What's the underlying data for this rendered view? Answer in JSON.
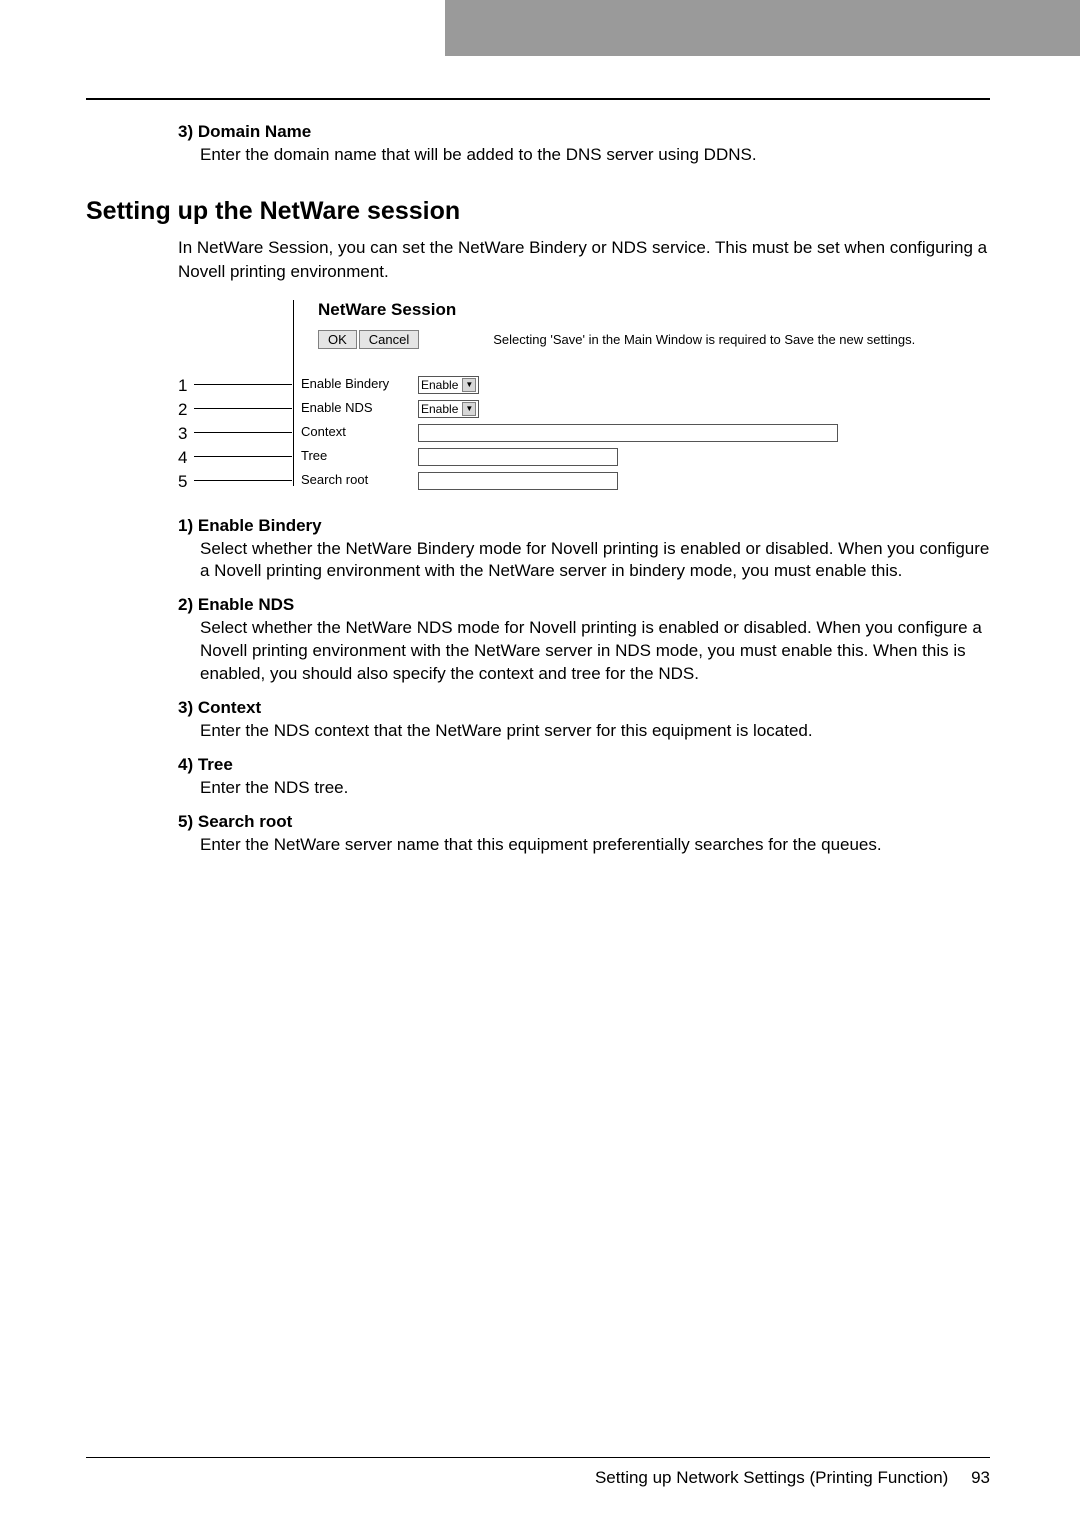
{
  "leadin_item": {
    "num": "3)",
    "title": "Domain Name",
    "body": "Enter the domain name that will be added to the DNS server using DDNS."
  },
  "section_heading": "Setting up the NetWare session",
  "section_intro": "In NetWare Session, you can set the NetWare Bindery or NDS service.  This must be set when configuring a Novell printing environment.",
  "screenshot": {
    "panel_title": "NetWare Session",
    "ok": "OK",
    "cancel": "Cancel",
    "save_note": "Selecting 'Save' in the Main Window is required to Save the new settings.",
    "rows": {
      "enable_bindery_label": "Enable Bindery",
      "enable_nds_label": "Enable NDS",
      "context_label": "Context",
      "tree_label": "Tree",
      "search_root_label": "Search root",
      "enable_option": "Enable"
    }
  },
  "callout_numbers": [
    "1",
    "2",
    "3",
    "4",
    "5"
  ],
  "items": [
    {
      "num": "1)",
      "title": "Enable Bindery",
      "body": "Select whether the NetWare Bindery mode for Novell printing is enabled or disabled.  When you configure a Novell printing environment with the NetWare server in bindery mode, you must enable this."
    },
    {
      "num": "2)",
      "title": "Enable NDS",
      "body": "Select whether the NetWare NDS mode for Novell printing is enabled or disabled.  When you configure a Novell printing environment with the NetWare server in NDS mode, you must enable this.  When this is enabled, you should also specify the context and tree for the NDS."
    },
    {
      "num": "3)",
      "title": "Context",
      "body": "Enter the NDS context that the NetWare print server for this equipment is located."
    },
    {
      "num": "4)",
      "title": "Tree",
      "body": "Enter the NDS tree."
    },
    {
      "num": "5)",
      "title": "Search root",
      "body": "Enter the NetWare server name that this equipment preferentially searches for the queues."
    }
  ],
  "footer": {
    "section": "Setting up Network Settings (Printing Function)",
    "page": "93"
  }
}
